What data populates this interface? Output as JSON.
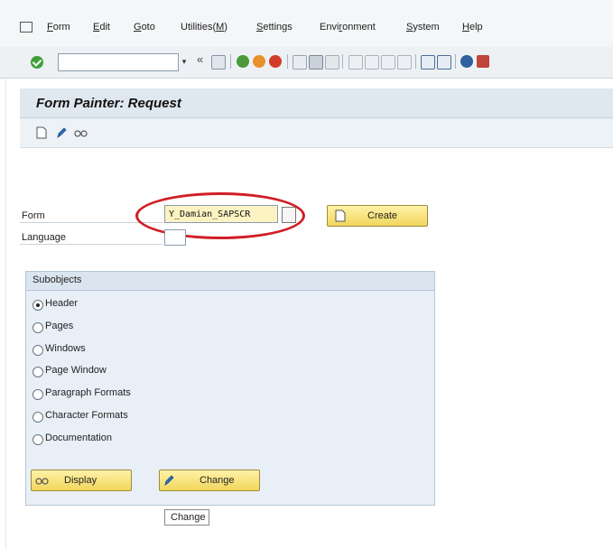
{
  "menu": {
    "items": [
      {
        "pre": "",
        "ul": "F",
        "post": "orm"
      },
      {
        "pre": "",
        "ul": "E",
        "post": "dit"
      },
      {
        "pre": "",
        "ul": "G",
        "post": "oto"
      },
      {
        "pre": "Utilities(",
        "ul": "M",
        "post": ")"
      },
      {
        "pre": "",
        "ul": "S",
        "post": "ettings"
      },
      {
        "pre": "Envi",
        "ul": "r",
        "post": "onment"
      },
      {
        "pre": "",
        "ul": "S",
        "post": "ystem"
      },
      {
        "pre": "",
        "ul": "H",
        "post": "elp"
      }
    ]
  },
  "toolbar": {
    "command_field_value": "",
    "dropdown_glyph": "▾",
    "history_glyph": "«"
  },
  "title": "Form Painter: Request",
  "form": {
    "form_label": "Form",
    "form_value": "Y_Damian_SAPSCR",
    "language_label": "Language",
    "create_label": "Create"
  },
  "subobjects": {
    "title": "Subobjects",
    "options": [
      {
        "label": "Header",
        "selected": true
      },
      {
        "label": "Pages",
        "selected": false
      },
      {
        "label": "Windows",
        "selected": false
      },
      {
        "label": "Page Window",
        "selected": false
      },
      {
        "label": "Paragraph Formats",
        "selected": false
      },
      {
        "label": "Character Formats",
        "selected": false
      },
      {
        "label": "Documentation",
        "selected": false
      }
    ]
  },
  "buttons": {
    "display_label": "Display",
    "change_label": "Change"
  },
  "tooltip": "Change",
  "colors": {
    "highlight_ellipse": "#d01e26",
    "input_required": "#fbf3c2",
    "button_fill": "#f1d65c"
  }
}
